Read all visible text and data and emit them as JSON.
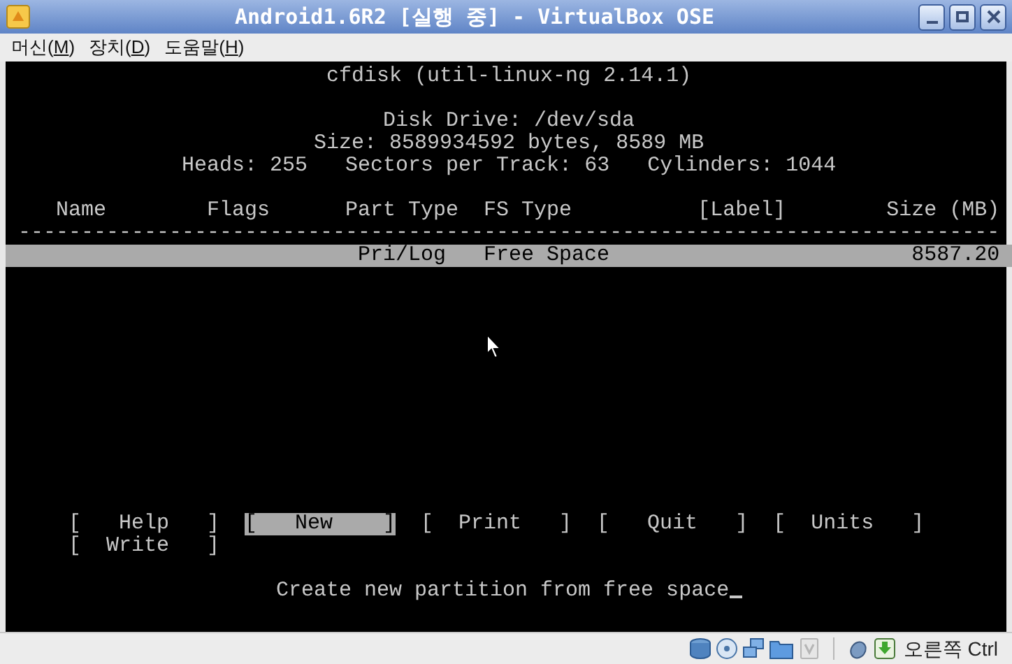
{
  "window": {
    "title": "Android1.6R2 [실행 중] - VirtualBox OSE"
  },
  "menu": [
    {
      "prefix": "머신(",
      "mnemonic": "M",
      "suffix": ")"
    },
    {
      "prefix": "장치(",
      "mnemonic": "D",
      "suffix": ")"
    },
    {
      "prefix": "도움말(",
      "mnemonic": "H",
      "suffix": ")"
    }
  ],
  "console": {
    "heading": "cfdisk (util-linux-ng 2.14.1)",
    "disk_info": [
      "Disk Drive: /dev/sda",
      "Size: 8589934592 bytes, 8589 MB",
      "Heads: 255   Sectors per Track: 63   Cylinders: 1044"
    ],
    "table": {
      "columns": [
        "Name",
        "Flags",
        "Part Type",
        "FS Type",
        "[Label]",
        "Size (MB)"
      ],
      "separator": "------------------------------------------------------------------------------",
      "rows": [
        {
          "part_type": "Pri/Log",
          "fs_type": "Free Space",
          "size": "8587.20",
          "selected": true
        }
      ]
    },
    "buttons": [
      {
        "label": "[   Help   ]",
        "selected": false
      },
      {
        "label": "[   New    ]",
        "selected": true
      },
      {
        "label": "[  Print   ]",
        "selected": false
      },
      {
        "label": "[   Quit   ]",
        "selected": false
      },
      {
        "label": "[  Units   ]",
        "selected": false
      },
      {
        "label": "[  Write   ]",
        "selected": false
      }
    ],
    "message": "Create new partition from free space"
  },
  "status_bar": {
    "host_key": "오른쪽 Ctrl"
  }
}
